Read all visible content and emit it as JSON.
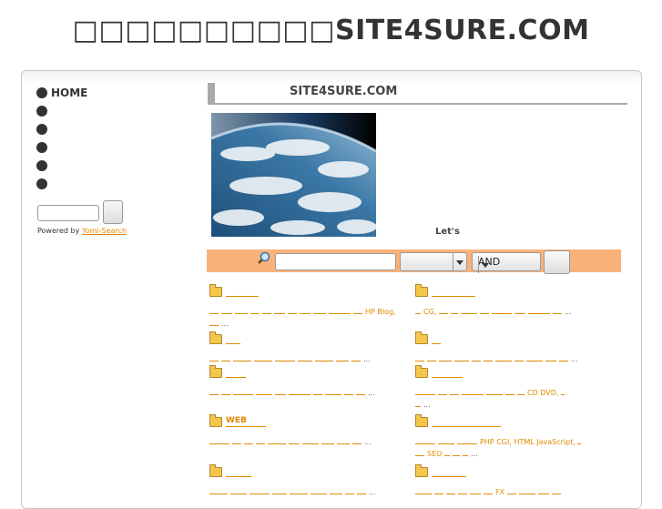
{
  "site_title": "□□□□□□□□□□SITE4SURE.COM",
  "sidebar": {
    "items": [
      {
        "label": "HOME"
      },
      {
        "label": ""
      },
      {
        "label": ""
      },
      {
        "label": ""
      },
      {
        "label": ""
      },
      {
        "label": ""
      }
    ],
    "powered_by_prefix": "Powered by",
    "powered_by_link": "Yomi-Search"
  },
  "main": {
    "heading": "SITE4SURE.COM",
    "lets_text": "Let's"
  },
  "search": {
    "keyword_value": "",
    "select1_value": "",
    "select2_value": "AND"
  },
  "categories": [
    {
      "title": "",
      "sub": [
        "HP Blog,"
      ],
      "ellipsis": "..."
    },
    {
      "title": "",
      "sub": [
        "CG,"
      ],
      "ellipsis": "..."
    },
    {
      "title": "",
      "sub": [],
      "ellipsis": "..."
    },
    {
      "title": "",
      "sub": [],
      "ellipsis": "..."
    },
    {
      "title": "",
      "sub": [],
      "ellipsis": "..."
    },
    {
      "title": "",
      "sub": [
        "CD DVD,"
      ],
      "ellipsis": "..."
    },
    {
      "title": "WEB",
      "sub": [],
      "ellipsis": "..."
    },
    {
      "title": "",
      "sub": [
        "PHP CGI,",
        "HTML JavaScript,",
        "SEO"
      ],
      "ellipsis": "..."
    },
    {
      "title": "",
      "sub": [],
      "ellipsis": "..."
    },
    {
      "title": "",
      "sub": [
        "FX"
      ],
      "ellipsis": ""
    }
  ]
}
